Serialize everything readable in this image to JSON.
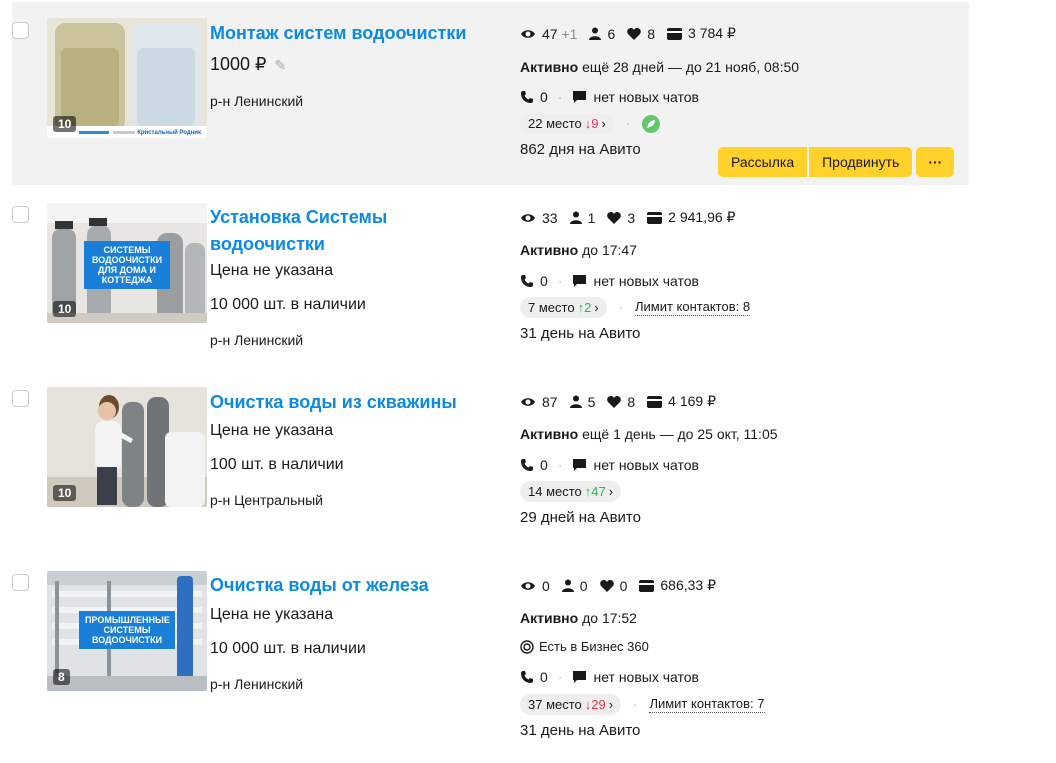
{
  "listings": [
    {
      "title": "Монтаж систем водоочистки",
      "price": "1000 ₽",
      "district": "р-н Ленинский",
      "photo_count": "10",
      "thumb_brand": "Кристальный Родник",
      "stats": {
        "views": "47",
        "views_extra": "+1",
        "contacts": "6",
        "favorites": "8",
        "spend": "3 784 ₽"
      },
      "status_label": "Активно",
      "status_text": "ещё 28 дней — до 21 нояб, 08:50",
      "calls": "0",
      "chats": "нет новых чатов",
      "rank": "22 место",
      "rank_delta": "↓9",
      "days": "862 дня на Авито",
      "actions": {
        "mailing": "Рассылка",
        "promote": "Продвинуть",
        "more": "···"
      }
    },
    {
      "title": "Установка Системы водоочистки",
      "price": "Цена не указана",
      "stock": "10 000 шт. в наличии",
      "district": "р-н Ленинский",
      "photo_count": "10",
      "thumb_banner": "Системы водоочистки для дома и коттеджа",
      "stats": {
        "views": "33",
        "contacts": "1",
        "favorites": "3",
        "spend": "2 941,96 ₽"
      },
      "status_label": "Активно",
      "status_text": "до 17:47",
      "calls": "0",
      "chats": "нет новых чатов",
      "rank": "7 место",
      "rank_delta": "↑2",
      "limit": "Лимит контактов: 8",
      "days": "31 день на Авито"
    },
    {
      "title": "Очистка воды из скважины",
      "price": "Цена не указана",
      "stock": "100 шт. в наличии",
      "district": "р-н Центральный",
      "photo_count": "10",
      "stats": {
        "views": "87",
        "contacts": "5",
        "favorites": "8",
        "spend": "4 169 ₽"
      },
      "status_label": "Активно",
      "status_text": "ещё 1 день — до 25 окт, 11:05",
      "calls": "0",
      "chats": "нет новых чатов",
      "rank": "14 место",
      "rank_delta": "↑47",
      "days": "29 дней на Авито"
    },
    {
      "title": "Очистка воды от железа",
      "price": "Цена не указана",
      "stock": "10 000 шт. в наличии",
      "district": "р-н Ленинский",
      "photo_count": "8",
      "thumb_banner": "Промышленные системы водоочистки",
      "stats": {
        "views": "0",
        "contacts": "0",
        "favorites": "0",
        "spend": "686,33 ₽"
      },
      "status_label": "Активно",
      "status_text": "до 17:52",
      "business": "Есть в Бизнес 360",
      "calls": "0",
      "chats": "нет новых чатов",
      "rank": "37 место",
      "rank_delta": "↓29",
      "limit": "Лимит контактов: 7",
      "days": "31 день на Авито"
    }
  ],
  "colors": {
    "title": "#0a8ae6",
    "button": "#ffd12a",
    "delta_down": "#e6334d",
    "delta_up": "#2eb84b",
    "highlight": "#f2f2f2"
  },
  "icons": [
    "eye-icon",
    "person-icon",
    "heart-icon",
    "wallet-icon",
    "phone-icon",
    "chat-icon",
    "rocket-icon",
    "target-icon",
    "pencil-icon"
  ]
}
